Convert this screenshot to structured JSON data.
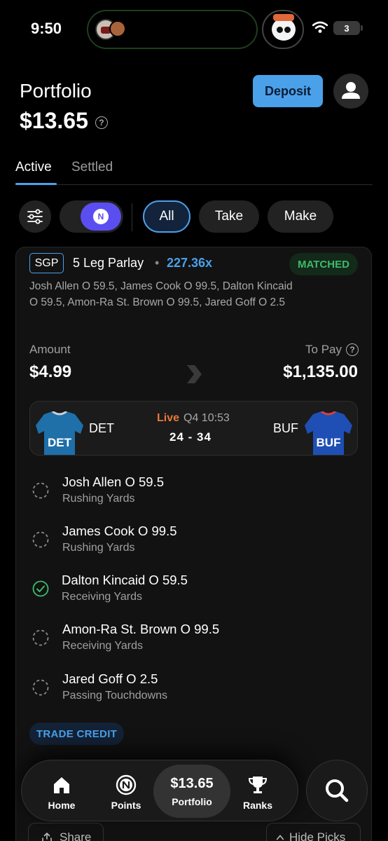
{
  "status_bar": {
    "time": "9:50",
    "battery": "3"
  },
  "header": {
    "title": "Portfolio",
    "balance": "$13.65",
    "help_glyph": "?",
    "deposit_label": "Deposit"
  },
  "tabs": [
    {
      "label": "Active"
    },
    {
      "label": "Settled"
    }
  ],
  "filters": {
    "toggle_glyph": "N",
    "chips": [
      {
        "label": "All"
      },
      {
        "label": "Take"
      },
      {
        "label": "Make"
      }
    ]
  },
  "bet": {
    "badge": "SGP",
    "title": "5 Leg Parlay",
    "separator": "•",
    "odds": "227.36x",
    "status": "MATCHED",
    "summary": "Josh Allen O 59.5, James Cook O 99.5, Dalton Kincaid O 59.5, Amon-Ra St. Brown O 99.5, Jared Goff O 2.5",
    "amount_label": "Amount",
    "amount": "$4.99",
    "topay_label": "To Pay",
    "topay": "$1,135.00",
    "game": {
      "home": "DET",
      "away": "BUF",
      "home_jersey_text": "DET",
      "away_jersey_text": "BUF",
      "live": "Live",
      "clock": "Q4 10:53",
      "score": "24 - 34"
    },
    "legs": [
      {
        "name": "Josh Allen O 59.5",
        "stat": "Rushing Yards",
        "status": "pending"
      },
      {
        "name": "James Cook O 99.5",
        "stat": "Rushing Yards",
        "status": "pending"
      },
      {
        "name": "Dalton Kincaid O 59.5",
        "stat": "Receiving Yards",
        "status": "hit"
      },
      {
        "name": "Amon-Ra St. Brown O 99.5",
        "stat": "Receiving Yards",
        "status": "pending"
      },
      {
        "name": "Jared Goff O 2.5",
        "stat": "Passing Touchdowns",
        "status": "pending"
      }
    ],
    "trade_credit": "TRADE CREDIT",
    "share_label": "Share",
    "hide_label": "Hide Picks"
  },
  "nav": {
    "home": "Home",
    "points": "Points",
    "portfolio_amount": "$13.65",
    "portfolio": "Portfolio",
    "ranks": "Ranks"
  },
  "colors": {
    "accent": "#4ba0ea",
    "matched": "#3fba6b",
    "live": "#e7793a",
    "toggle": "#5b4ef0"
  }
}
